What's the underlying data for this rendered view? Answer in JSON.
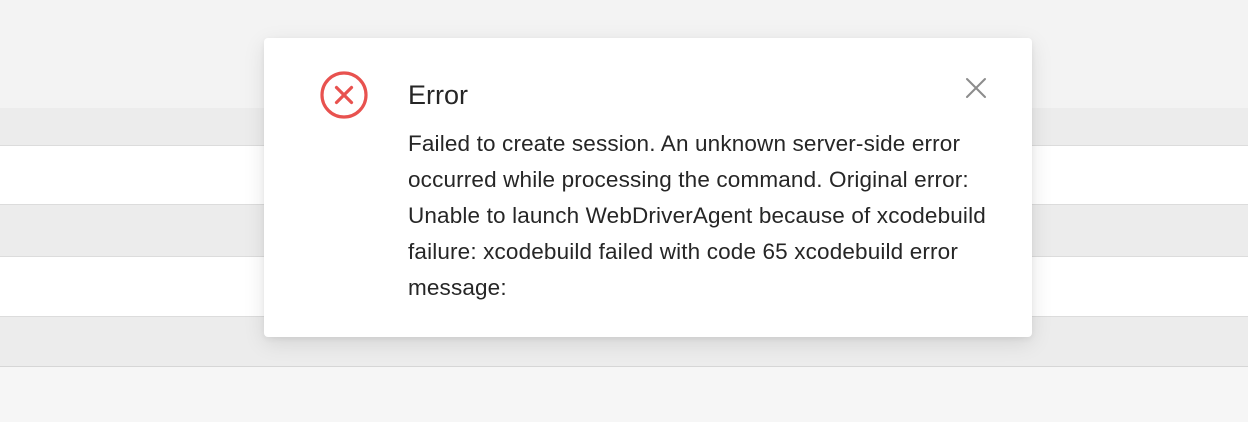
{
  "dialog": {
    "title": "Error",
    "message": "Failed to create session. An unknown server-side error occurred while processing the command. Original error: Unable to launch WebDriverAgent because of xcodebuild failure: xcodebuild failed with code 65 xcodebuild error message:",
    "icon": "error-circle-x-icon",
    "close_icon": "close-icon"
  },
  "colors": {
    "error": "#e8524f",
    "text": "#262626",
    "close": "#8c8c8c"
  }
}
